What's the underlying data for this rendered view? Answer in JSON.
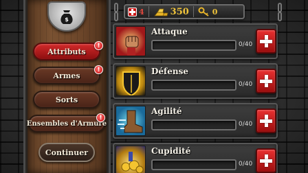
{
  "menu": {
    "items": [
      {
        "label": "Attributs",
        "active": true,
        "alert": "!"
      },
      {
        "label": "Armes",
        "active": false,
        "alert": "!"
      },
      {
        "label": "Sorts",
        "active": false,
        "alert": ""
      },
      {
        "label": "Ensembles d'Armure",
        "active": false,
        "alert": "!"
      }
    ],
    "continue_label": "Continuer"
  },
  "resources": {
    "health": "4",
    "gold": "350",
    "keys": "0"
  },
  "stats": [
    {
      "name": "Attaque",
      "count": "0/40",
      "progress": 0,
      "icon": "fist-icon"
    },
    {
      "name": "Défense",
      "count": "0/40",
      "progress": 0,
      "icon": "shield-icon"
    },
    {
      "name": "Agilité",
      "count": "0/40",
      "progress": 0,
      "icon": "boot-icon"
    },
    {
      "name": "Cupidité",
      "count": "0/40",
      "progress": 0,
      "icon": "treasure-icon"
    }
  ],
  "colors": {
    "active_button": "#d22a2a",
    "plus_button": "#e83030",
    "gold": "#f0c43a",
    "health": "#e0483d"
  }
}
